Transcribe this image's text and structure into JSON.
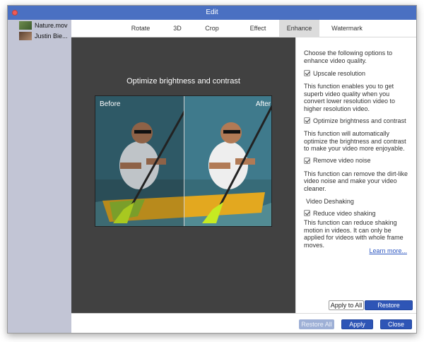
{
  "window": {
    "title": "Edit"
  },
  "sidebar": {
    "files": [
      {
        "label": "Nature.mov"
      },
      {
        "label": "Justin Bie..."
      }
    ]
  },
  "tabs": [
    {
      "label": "Rotate",
      "active": false
    },
    {
      "label": "3D",
      "active": false
    },
    {
      "label": "Crop",
      "active": false
    },
    {
      "label": "Effect",
      "active": false
    },
    {
      "label": "Enhance",
      "active": true
    },
    {
      "label": "Watermark",
      "active": false
    }
  ],
  "preview": {
    "title": "Optimize brightness and contrast",
    "before_label": "Before",
    "after_label": "After"
  },
  "enhance": {
    "intro": "Choose the following options to enhance video quality.",
    "options": [
      {
        "label": "Upscale resolution",
        "checked": true,
        "description": "This function enables you to get superb video quality when you convert lower resolution video to higher resolution video."
      },
      {
        "label": "Optimize brightness and contrast",
        "checked": true,
        "description": "This function will automatically optimize the brightness and contrast to make your video more enjoyable."
      },
      {
        "label": "Remove video noise",
        "checked": true,
        "description": "This function can remove the dirt-like video noise and make your video cleaner."
      }
    ],
    "deshake_section": "Video Deshaking",
    "deshake": {
      "label": "Reduce video shaking",
      "checked": true,
      "description": "This function can reduce shaking motion in videos. It can only be applied for videos with whole frame moves."
    },
    "learn_more": "Learn more...",
    "apply_all": "Apply to All",
    "restore_defaults": "Restore Defaults"
  },
  "footer": {
    "restore_all": "Restore All",
    "apply": "Apply",
    "close": "Close"
  },
  "colors": {
    "titlebar": "#4a70c2",
    "sidebar": "#c2c5d5",
    "preview_bg": "#414141",
    "button_primary": "#2e55b6",
    "link": "#2b55c0"
  }
}
